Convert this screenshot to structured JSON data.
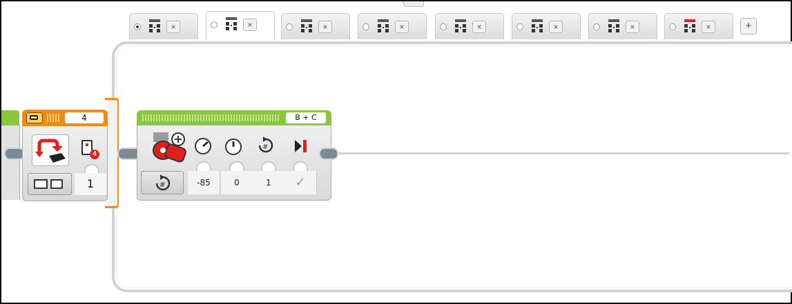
{
  "tabs": [
    {
      "active": false,
      "selected": true,
      "indicator_color": "#555555",
      "close_label": "×"
    },
    {
      "active": true,
      "selected": false,
      "indicator_color": "#555555",
      "close_label": "×"
    },
    {
      "active": false,
      "selected": false,
      "indicator_color": "#555555",
      "close_label": "×"
    },
    {
      "active": false,
      "selected": false,
      "indicator_color": "#555555",
      "close_label": "×"
    },
    {
      "active": false,
      "selected": false,
      "indicator_color": "#555555",
      "close_label": "×"
    },
    {
      "active": false,
      "selected": false,
      "indicator_color": "#555555",
      "close_label": "×"
    },
    {
      "active": false,
      "selected": false,
      "indicator_color": "#555555",
      "close_label": "×"
    },
    {
      "active": false,
      "selected": false,
      "indicator_color": "#e02020",
      "close_label": "×"
    }
  ],
  "add_tab_label": "+",
  "wait_block": {
    "header_value": "4",
    "port_value": "1",
    "port_badge": "4",
    "colors": {
      "header": "#f08a1a",
      "icon": "#e0201c"
    }
  },
  "motor_block": {
    "ports_label": "B + C",
    "params": [
      {
        "name": "power",
        "icon": "speedometer-icon",
        "value": "-85"
      },
      {
        "name": "steering",
        "icon": "dial-icon",
        "value": "0"
      },
      {
        "name": "rotations",
        "icon": "rotations-icon",
        "value": "1"
      },
      {
        "name": "brake",
        "icon": "brake-icon",
        "value": "✓"
      }
    ],
    "colors": {
      "header": "#8cc63f",
      "motor": "#e0201c"
    }
  },
  "colors": {
    "loop_frame": "#d2d2d2",
    "loop_orange": "#f08a1a",
    "block_green": "#8cc63f",
    "accent_red": "#e0201c"
  }
}
